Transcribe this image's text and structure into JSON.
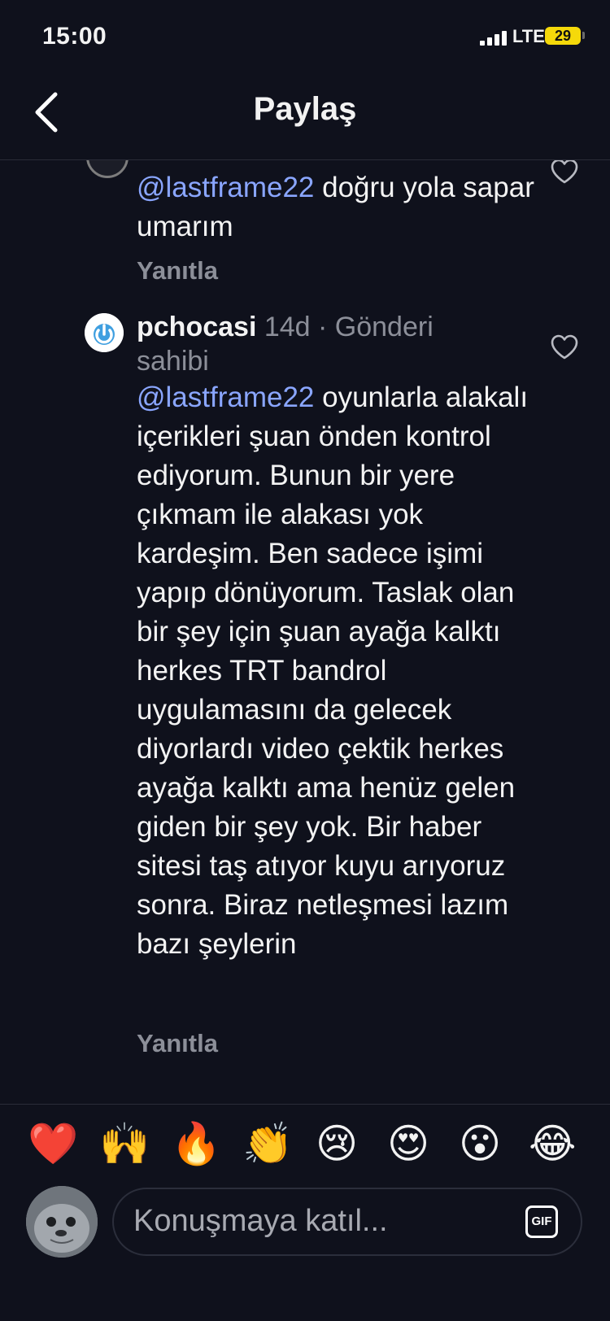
{
  "status_bar": {
    "time": "15:00",
    "network": "LTE",
    "battery": "29"
  },
  "nav": {
    "title": "Paylaş",
    "back_icon": "chevron-left-icon"
  },
  "comments": [
    {
      "mention": "@lastframe22",
      "text": " doğru yola sapar umarım",
      "reply_label": "Yanıtla"
    },
    {
      "username": "pchocasi",
      "time": "14d",
      "meta_suffix": " · Gönderi sahibi",
      "mention": "@lastframe22",
      "text": " oyunlarla alakalı içerikleri şuan önden kontrol ediyorum. Bunun bir yere çıkmam ile alakası yok kardeşim. Ben sadece işimi yapıp dönüyorum. Taslak olan bir şey için şuan ayağa kalktı herkes TRT bandrol uygulamasını da gelecek diyorlardı video çektik herkes ayağa kalktı ama henüz gelen giden bir şey yok. Bir haber sitesi taş atıyor kuyu arıyoruz sonra. Biraz netleşmesi lazım bazı şeylerin",
      "reply_label": "Yanıtla"
    }
  ],
  "emoji_bar": [
    "❤️",
    "🙌",
    "🔥",
    "👏",
    "😢",
    "😍",
    "😮",
    "😂"
  ],
  "composer": {
    "placeholder": "Konuşmaya katıl...",
    "gif_label": "GIF"
  },
  "colors": {
    "background": "#0f111c",
    "mention": "#8aa6ff",
    "muted": "#8c8f99",
    "battery": "#f5d90a"
  }
}
